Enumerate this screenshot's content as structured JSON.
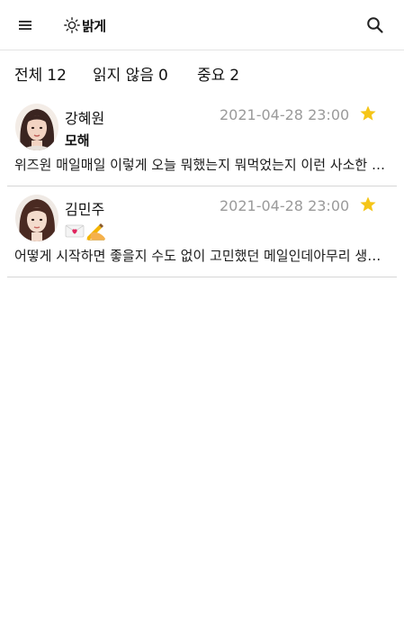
{
  "header": {
    "theme_label": "밝게",
    "icons": {
      "menu": "menu-icon",
      "theme": "sun-icon",
      "search": "search-icon"
    }
  },
  "filters": [
    {
      "label": "전체",
      "count": "12"
    },
    {
      "label": "읽지 않음",
      "count": "0"
    },
    {
      "label": "중요",
      "count": "2"
    }
  ],
  "mails": [
    {
      "sender": "강혜원",
      "date": "2021-04-28 23:00",
      "subject": "모해",
      "preview": "위즈원 매일매일 이렇게 오늘 뭐했는지 뭐먹었는지 이런 사소한 이야기들 나누고 싶어요",
      "starred": true,
      "star_color": "#f5c518"
    },
    {
      "sender": "김민주",
      "date": "2021-04-28 23:00",
      "subject": "💌✍️",
      "preview": "어떻게 시작하면 좋을지 수도 없이 고민했던 메일인데아무리 생각해도 잘 모르겠어요",
      "starred": true,
      "star_color": "#f5c518"
    }
  ]
}
